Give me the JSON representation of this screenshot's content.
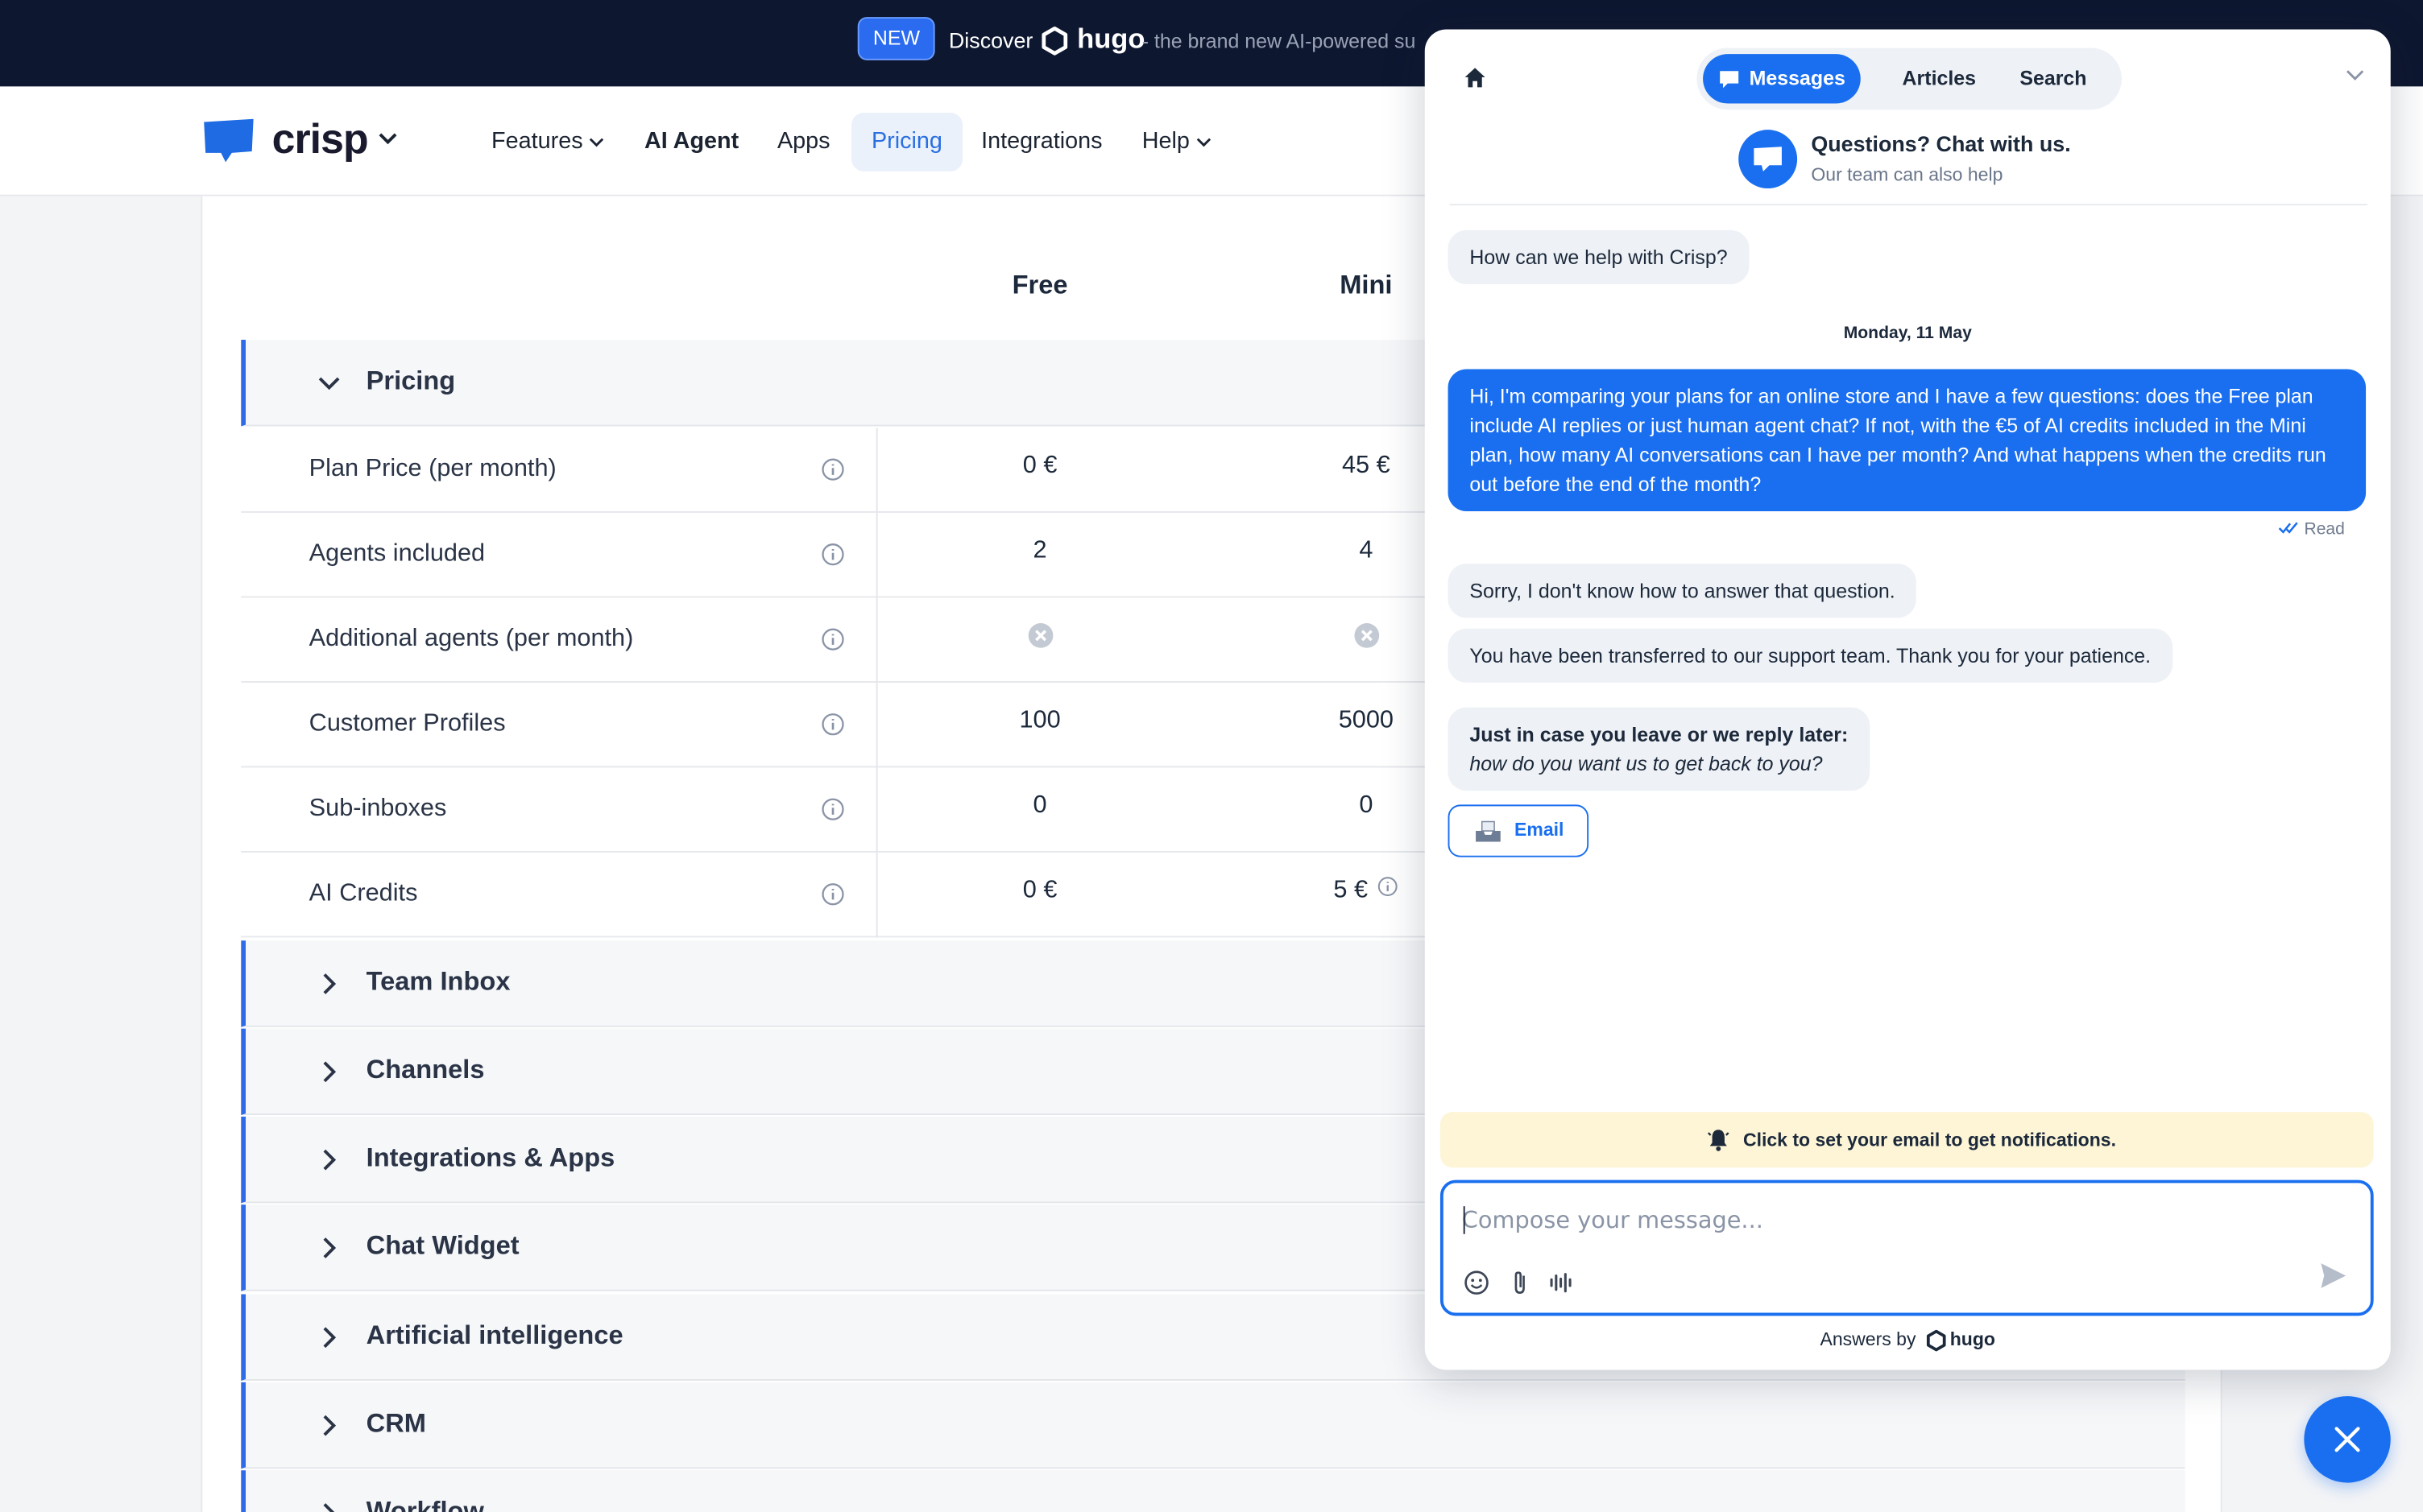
{
  "announcement": {
    "badge": "NEW",
    "discover": "Discover",
    "brand": "hugo",
    "tagline": "- the brand new AI-powered su"
  },
  "nav": {
    "logo": "crisp",
    "items": [
      {
        "label": "Features"
      },
      {
        "label": "AI Agent"
      },
      {
        "label": "Apps"
      },
      {
        "label": "Pricing"
      },
      {
        "label": "Integrations"
      },
      {
        "label": "Help"
      }
    ]
  },
  "table": {
    "columns": [
      "Free",
      "Mini"
    ],
    "open_section": "Pricing",
    "rows": [
      {
        "label": "Plan Price (per month)",
        "free": "0 €",
        "mini": "45 €"
      },
      {
        "label": "Agents included",
        "free": "2",
        "mini": "4"
      },
      {
        "label": "Additional agents (per month)",
        "free": "",
        "mini": ""
      },
      {
        "label": "Customer Profiles",
        "free": "100",
        "mini": "5000"
      },
      {
        "label": "Sub-inboxes",
        "free": "0",
        "mini": "0"
      },
      {
        "label": "AI Credits",
        "free": "0 €",
        "mini": "5 €"
      }
    ],
    "collapsed_sections": [
      "Team Inbox",
      "Channels",
      "Integrations & Apps",
      "Chat Widget",
      "Artificial intelligence",
      "CRM",
      "Workflow"
    ]
  },
  "chat": {
    "tabs": [
      "Messages",
      "Articles",
      "Search"
    ],
    "header_title": "Questions? Chat with us.",
    "header_sub": "Our team can also help",
    "messages": {
      "greeting": "How can we help with Crisp?",
      "date": "Monday, 11 May",
      "user": "Hi, I'm comparing your plans for an online store and I have a few questions: does the Free plan include AI replies or just human agent chat? If not, with the €5 of AI credits included in the Mini plan, how many AI conversations can I have per month? And what happens when the credits run out before the end of the month?",
      "read": "Read",
      "bot1": "Sorry, I don't know how to answer that question.",
      "bot2": "You have been transferred to our support team. Thank you for your patience.",
      "leave_title": "Just in case you leave or we reply later:",
      "leave_sub": "how do you want us to get back to you?",
      "email_button": "Email"
    },
    "notif": "Click to set your email to get notifications.",
    "composer_placeholder": "Compose your message...",
    "answers_by": "Answers by",
    "answers_brand": "hugo"
  },
  "colors": {
    "accent": "#1a6ff0",
    "topbar": "#0e1730",
    "notif": "#fdf5d6"
  }
}
